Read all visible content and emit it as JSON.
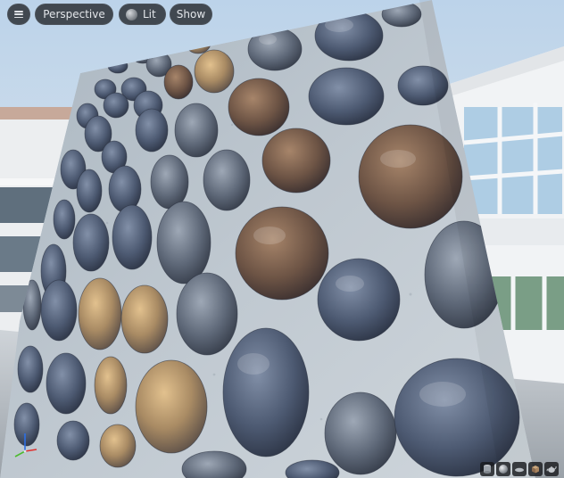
{
  "toolbar": {
    "menu_icon": "hamburger-menu-icon",
    "view_mode_label": "Perspective",
    "lighting_mode_label": "Lit",
    "lighting_icon": "lit-sphere-icon",
    "show_label": "Show"
  },
  "viewport": {
    "axis_labels": {
      "x": "",
      "y": "",
      "z": ""
    },
    "axis_colors": {
      "x": "#e0302f",
      "y": "#4bbb2e",
      "z": "#2c6fe5"
    }
  },
  "preview_shapes": [
    {
      "name": "cylinder",
      "icon": "cylinder-icon"
    },
    {
      "name": "sphere",
      "icon": "sphere-icon"
    },
    {
      "name": "plane",
      "icon": "plane-icon"
    },
    {
      "name": "cube",
      "icon": "cube-icon"
    },
    {
      "name": "teapot",
      "icon": "teapot-icon"
    }
  ]
}
